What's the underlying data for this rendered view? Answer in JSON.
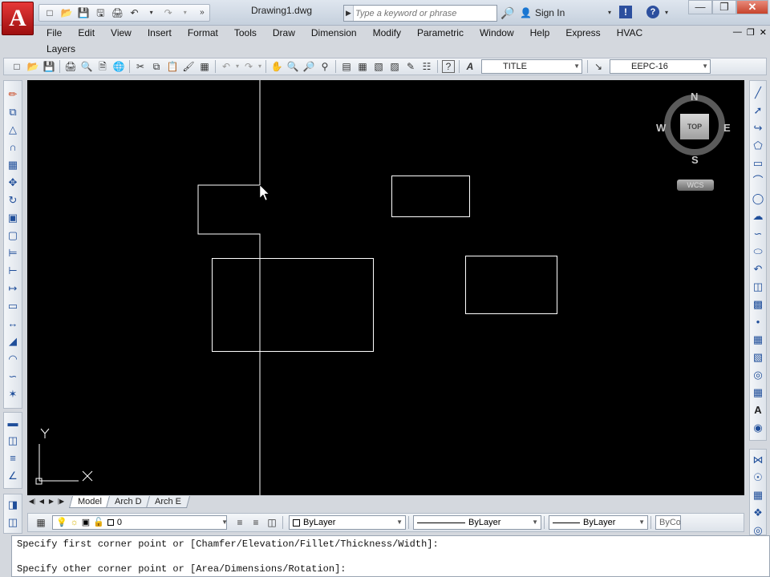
{
  "titlebar": {
    "app_logo": "A",
    "document_title": "Drawing1.dwg",
    "search_placeholder": "Type a keyword or phrase",
    "sign_in": "Sign In",
    "qat_icons": [
      "new-icon",
      "open-icon",
      "save-icon",
      "save-as-icon",
      "print-icon",
      "undo-icon",
      "redo-icon",
      "more-icon"
    ],
    "window_buttons": [
      "minimize",
      "restore",
      "close"
    ]
  },
  "menu": {
    "items": [
      "File",
      "Edit",
      "View",
      "Insert",
      "Format",
      "Tools",
      "Draw",
      "Dimension",
      "Modify",
      "Parametric",
      "Window",
      "Help",
      "Express",
      "HVAC"
    ],
    "second_row": "Layers"
  },
  "standard_toolbar": {
    "text_style": "TITLE",
    "dim_style": "EEPC-16"
  },
  "viewcube": {
    "north": "N",
    "south": "S",
    "east": "E",
    "west": "W",
    "face": "TOP",
    "wcs": "WCS"
  },
  "ucs": {
    "x_label": "X",
    "y_label": "Y"
  },
  "layout_tabs": [
    "Model",
    "Arch D",
    "Arch E"
  ],
  "active_tab": "Model",
  "properties_bar": {
    "layer": "0",
    "color": "ByLayer",
    "linetype": "ByLayer",
    "lineweight": "ByLayer",
    "plotstyle": "ByCo"
  },
  "command_line": {
    "line1": "Specify first corner point or [Chamfer/Elevation/Fillet/Thickness/Width]:",
    "line2": "Specify other corner point or [Area/Dimensions/Rotation]:"
  },
  "colors": {
    "canvas_bg": "#000000",
    "drawing_lines": "#ffffff",
    "chrome_bg": "#d4d8de",
    "logo_red": "#c41e1e"
  }
}
